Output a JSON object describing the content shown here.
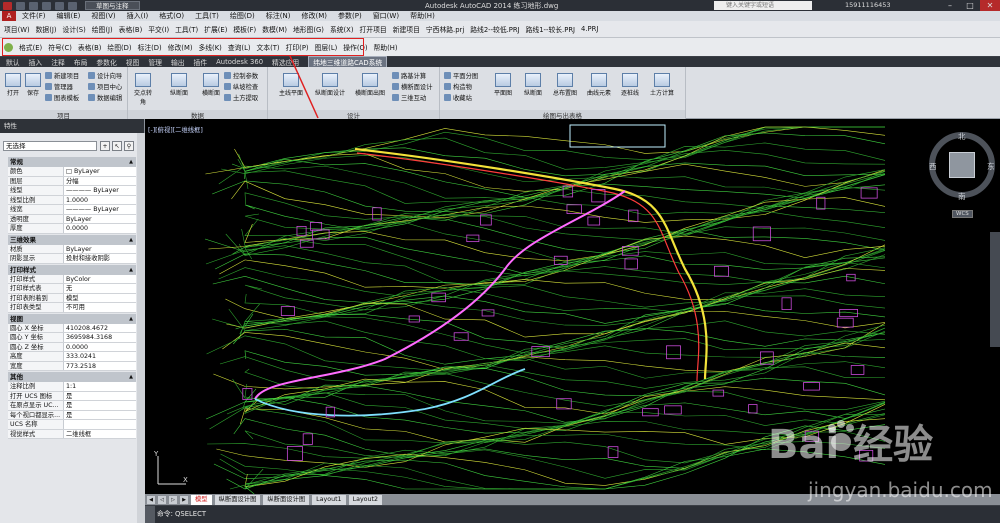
{
  "window": {
    "title": "Autodesk AutoCAD 2014  练习地形.dwg",
    "workspace": "草图与注释",
    "search_placeholder": "键入关键字或短语",
    "user": "15911116453"
  },
  "menubar": [
    "文件(F)",
    "编辑(E)",
    "视图(V)",
    "插入(I)",
    "格式(O)",
    "工具(T)",
    "绘图(D)",
    "标注(N)",
    "修改(M)",
    "参数(P)",
    "窗口(W)",
    "帮助(H)"
  ],
  "project_menu": [
    "项目(W)",
    "数据(J)",
    "设计(S)",
    "绘图(J)",
    "表格(B)",
    "平交(I)",
    "工具(T)",
    "扩展(E)",
    "模板(F)",
    "数模(M)",
    "地形图(G)",
    "系统(X)",
    "打开项目",
    "新建项目",
    "宁西林路.prj",
    "路线2--较低.PRJ",
    "路线1--较长.PRJ",
    "4.PRJ"
  ],
  "plugin_menu": [
    "格式(E)",
    "符号(C)",
    "表格(B)",
    "绘图(D)",
    "标注(D)",
    "修改(M)",
    "多线(K)",
    "查询(L)",
    "文本(T)",
    "打印(P)",
    "图层(L)",
    "操作(O)",
    "帮助(H)"
  ],
  "ribbon_tabs": [
    "默认",
    "插入",
    "注释",
    "布局",
    "参数化",
    "视图",
    "管理",
    "输出",
    "插件",
    "Autodesk 360",
    "精选应用",
    "纬地三维道路CAD系统"
  ],
  "ribbon": {
    "panels": [
      {
        "title": "项目",
        "big": [
          "打开",
          "保存"
        ],
        "small": [
          "新建项目",
          "管理器",
          "图表模板",
          "设计向导",
          "项目中心",
          "数据编辑"
        ]
      },
      {
        "title": "数据",
        "big": [
          "交点转角",
          "纵断面",
          "横断面"
        ],
        "small": [
          "控制参数",
          "纵坡检查",
          "土方提取"
        ]
      },
      {
        "title": "设计",
        "big": [
          "主线平面",
          "纵断面设计",
          "横断面出图",
          "路基计算",
          "横断面设计",
          "三维互动"
        ],
        "small": [
          "路基计算",
          "横断面设计",
          "三维互动"
        ]
      },
      {
        "title": "绘图与出表格",
        "big": [
          "平面图",
          "纵断面",
          "总布置图",
          "曲线元素",
          "逐桩线",
          "土方计算"
        ],
        "small": [
          "平面分图",
          "构造物",
          "收藏站"
        ]
      }
    ]
  },
  "properties": {
    "header": "特性",
    "selection": "无选择",
    "sections": [
      {
        "name": "常规",
        "rows": [
          [
            "颜色",
            "□ ByLayer"
          ],
          [
            "图层",
            "分幅"
          ],
          [
            "线型",
            "———— ByLayer"
          ],
          [
            "线型比例",
            "1.0000"
          ],
          [
            "线宽",
            "———— ByLayer"
          ],
          [
            "透明度",
            "ByLayer"
          ],
          [
            "厚度",
            "0.0000"
          ]
        ]
      },
      {
        "name": "三维效果",
        "rows": [
          [
            "材质",
            "ByLayer"
          ],
          [
            "阴影显示",
            "投射和接收阴影"
          ]
        ]
      },
      {
        "name": "打印样式",
        "rows": [
          [
            "打印样式",
            "ByColor"
          ],
          [
            "打印样式表",
            "无"
          ],
          [
            "打印表附着到",
            "模型"
          ],
          [
            "打印表类型",
            "不可用"
          ]
        ]
      },
      {
        "name": "视图",
        "rows": [
          [
            "圆心 X 坐标",
            "410208.4672"
          ],
          [
            "圆心 Y 坐标",
            "3695984.3168"
          ],
          [
            "圆心 Z 坐标",
            "0.0000"
          ],
          [
            "高度",
            "333.0241"
          ],
          [
            "宽度",
            "773.2518"
          ]
        ]
      },
      {
        "name": "其他",
        "rows": [
          [
            "注释比例",
            "1:1"
          ],
          [
            "打开 UCS 图标",
            "是"
          ],
          [
            "在原点显示 UC...",
            "是"
          ],
          [
            "每个视口都显示...",
            "是"
          ],
          [
            "UCS 名称",
            ""
          ],
          [
            "视觉样式",
            "二维线框"
          ]
        ]
      }
    ]
  },
  "viewport": {
    "label": "[-][俯视][二维线框]",
    "compass": {
      "n": "北",
      "s": "南",
      "e": "东",
      "w": "西"
    },
    "wcs": "WCS"
  },
  "layout_tabs": [
    "模型",
    "纵断面设计图",
    "纵断面设计图",
    "Layout1",
    "Layout2"
  ],
  "command_line": "命令: QSELECT",
  "watermark": {
    "logo": "Bai  经验",
    "url": "jingyan.baidu.com"
  }
}
